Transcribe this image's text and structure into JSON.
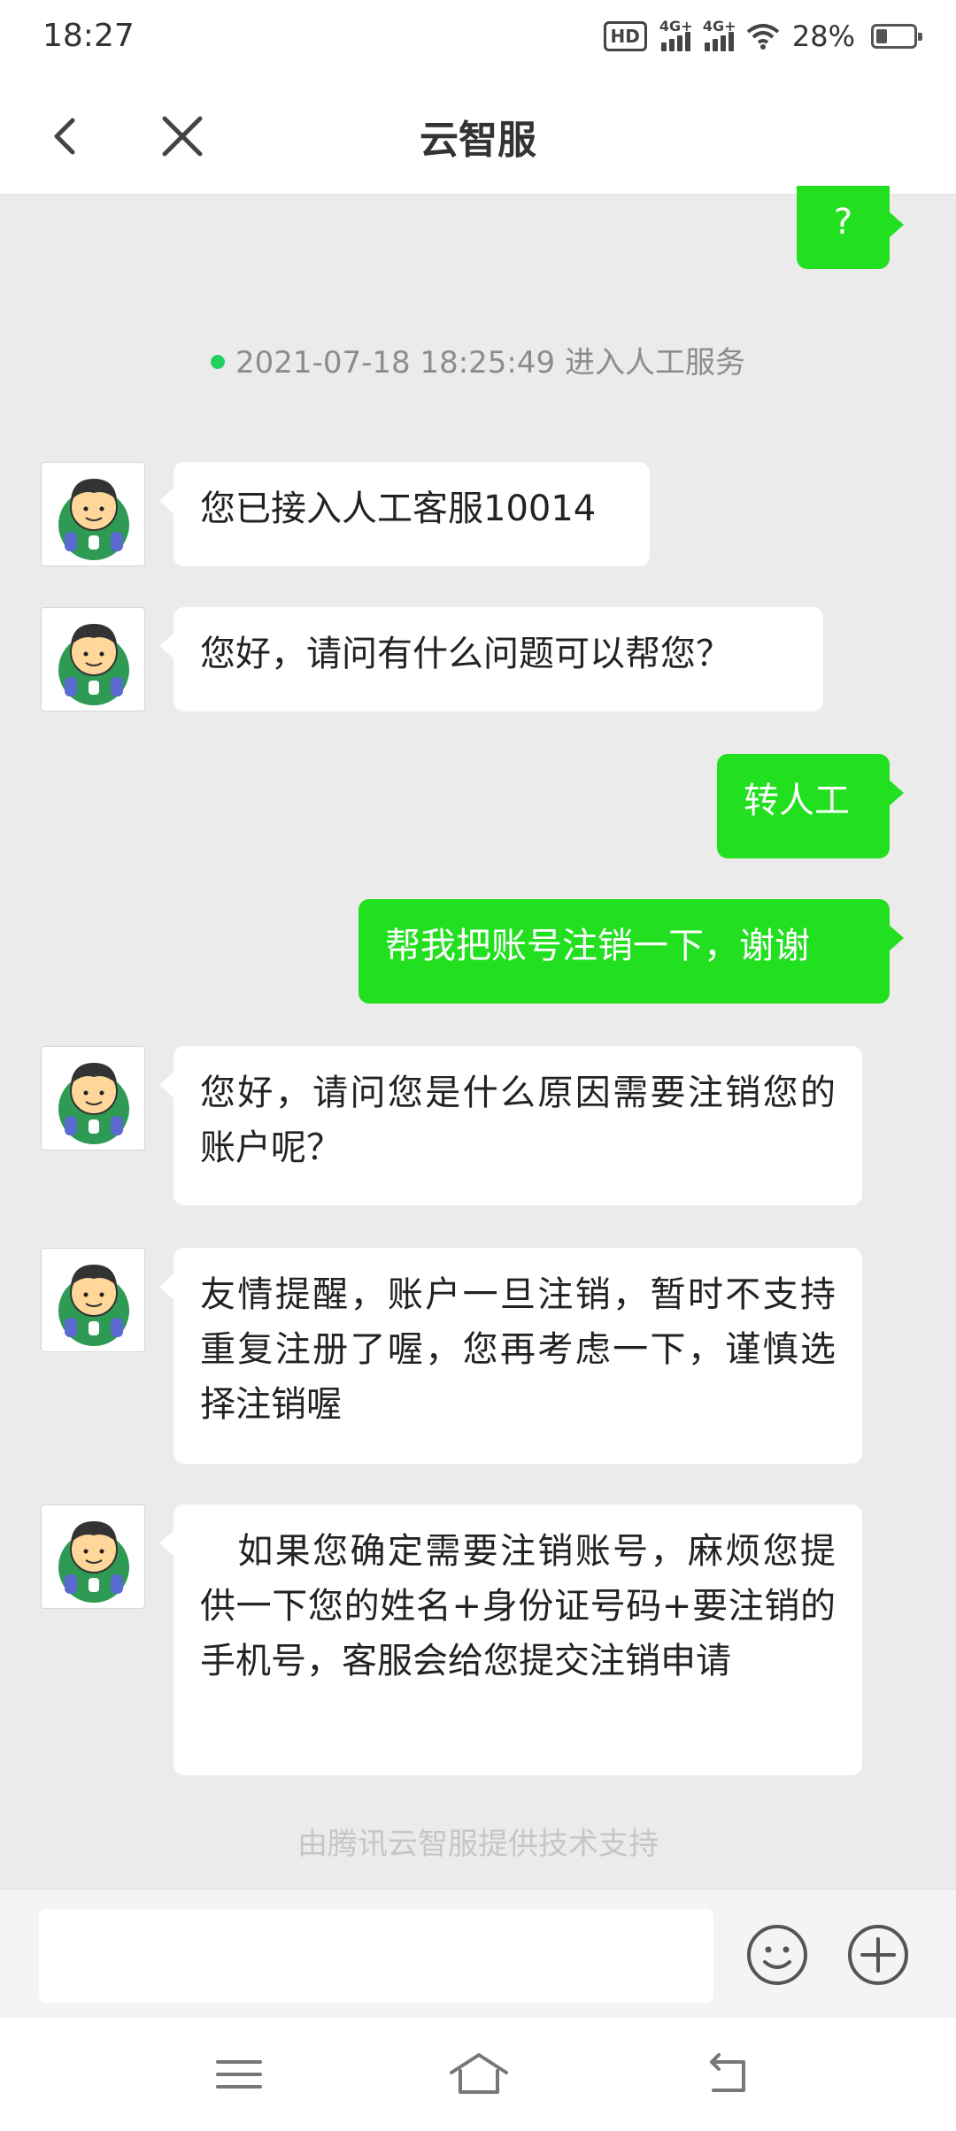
{
  "status_bar": {
    "time": "18:27",
    "hd_label": "HD",
    "network_1": "4G+",
    "network_2": "4G+",
    "battery": "28%"
  },
  "header": {
    "title": "云智服"
  },
  "chat": {
    "top_user_message": "?",
    "system_note": "2021-07-18 18:25:49 进入人工服务",
    "messages": [
      {
        "from": "agent",
        "text": "您已接入人工客服10014"
      },
      {
        "from": "agent",
        "text": "您好，请问有什么问题可以帮您？"
      },
      {
        "from": "user",
        "text": "转人工"
      },
      {
        "from": "user",
        "text": "帮我把账号注销一下，谢谢"
      },
      {
        "from": "agent",
        "text": "您好，请问您是什么原因需要注销您的账户呢？"
      },
      {
        "from": "agent",
        "text": "友情提醒，账户一旦注销，暂时不支持重复注册了喔，您再考虑一下，谨慎选择注销喔"
      },
      {
        "from": "agent",
        "text": "　如果您确定需要注销账号，麻烦您提供一下您的姓名+身份证号码+要注销的手机号，客服会给您提交注销申请"
      }
    ],
    "footer_note": "由腾讯云智服提供技术支持"
  },
  "input": {
    "value": "",
    "placeholder": ""
  },
  "colors": {
    "user_bubble": "#22e020",
    "agent_bubble": "#ffffff",
    "background": "#ebebeb",
    "system_dot": "#22d060"
  },
  "icons": {
    "back": "back-arrow-icon",
    "close": "close-icon",
    "emoji": "smiley-icon",
    "plus": "plus-icon",
    "menu": "menu-icon",
    "home": "home-icon",
    "nav_back": "return-icon"
  }
}
